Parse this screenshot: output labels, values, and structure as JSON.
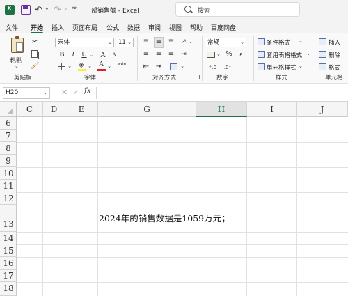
{
  "titlebar": {
    "document_title": "一部销售额 - Excel",
    "search_placeholder": "搜索",
    "more_symbol": "≂",
    "dropdown_symbol": "⌄"
  },
  "menu": {
    "tabs": [
      "文件",
      "开始",
      "插入",
      "页面布局",
      "公式",
      "数据",
      "审阅",
      "视图",
      "帮助",
      "百度网盘"
    ],
    "active_tab": "开始"
  },
  "ribbon": {
    "clipboard": {
      "paste_label": "粘贴",
      "group_label": "剪贴板"
    },
    "font": {
      "font_name": "宋体",
      "font_size": "11",
      "bold": "B",
      "italic": "I",
      "underline": "U",
      "grow": "A",
      "shrink": "A",
      "font_color_glyph": "A",
      "phonetic": "wén",
      "group_label": "字体"
    },
    "alignment": {
      "group_label": "对齐方式"
    },
    "number": {
      "format": "常规",
      "percent": "%",
      "comma": ",",
      "group_label": "数字"
    },
    "styles": {
      "conditional_format": "条件格式",
      "table_format": "套用表格格式",
      "cell_styles": "单元格样式",
      "group_label": "样式"
    },
    "cells": {
      "insert": "插入",
      "delete": "删除",
      "format": "格式",
      "group_label": "单元格"
    }
  },
  "formula_bar": {
    "name_box": "H20",
    "fx": "fx",
    "cancel": "✕",
    "enter": "✓",
    "content": ""
  },
  "grid": {
    "columns": [
      "C",
      "D",
      "E",
      "G",
      "H",
      "I",
      "J"
    ],
    "selected_column": "H",
    "rows": [
      "6",
      "7",
      "8",
      "9",
      "10",
      "11",
      "12",
      "13",
      "14",
      "15",
      "16",
      "17",
      "18"
    ],
    "cell_G13": "2024年的销售数据是1059万元；"
  },
  "colors": {
    "accent": "#1e7145",
    "title_bg": "#f3f3f3",
    "ribbon_bg": "#f9f9f9"
  }
}
